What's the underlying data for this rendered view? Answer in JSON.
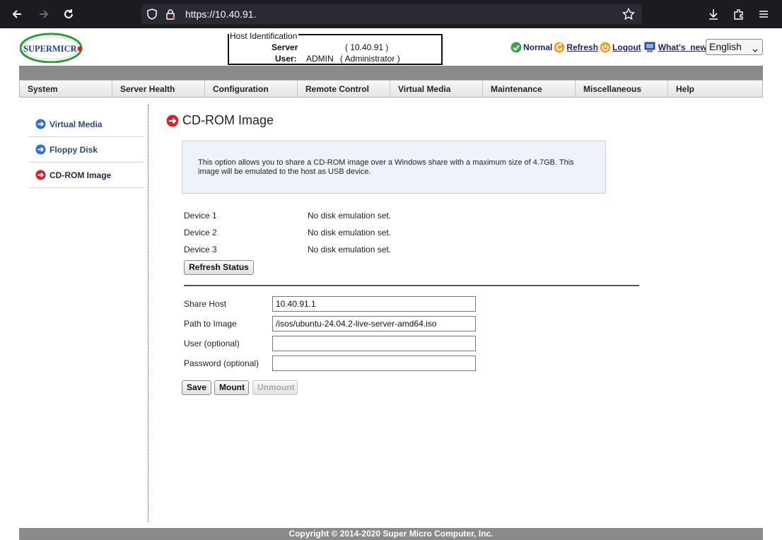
{
  "browser": {
    "url_main": "https://10.40.91.",
    "icons": [
      "back-icon",
      "forward-icon",
      "reload-icon",
      "shield-icon",
      "lock-icon",
      "bookmark-star-icon",
      "download-icon",
      "extensions-icon",
      "menu-icon"
    ]
  },
  "header": {
    "logo_text": "SUPERMICRO",
    "host_box": {
      "legend": "Host Identification",
      "server_label": "Server",
      "server_value": "( 10.40.91          )",
      "user_label": "User:",
      "user_name": "ADMIN",
      "user_role": "( Administrator )"
    },
    "status_label": "Normal",
    "refresh_label": "Refresh",
    "logout_label": "Logout",
    "whats_new_label": "What's_new",
    "language": "English"
  },
  "menu": {
    "items": [
      "System",
      "Server Health",
      "Configuration",
      "Remote Control",
      "Virtual Media",
      "Maintenance",
      "Miscellaneous",
      "Help"
    ]
  },
  "sidebar": {
    "items": [
      {
        "label": "Virtual Media",
        "active": false
      },
      {
        "label": "Floppy Disk",
        "active": false
      },
      {
        "label": "CD-ROM Image",
        "active": true
      }
    ]
  },
  "content": {
    "title": "CD-ROM Image",
    "info": "This option allows you to share a CD-ROM image over a Windows share with a maximum size of 4.7GB. This image will be emulated to the host as USB device.",
    "devices": [
      {
        "label": "Device 1",
        "status": "No disk emulation set."
      },
      {
        "label": "Device 2",
        "status": "No disk emulation set."
      },
      {
        "label": "Device 3",
        "status": "No disk emulation set."
      }
    ],
    "refresh_status_button": "Refresh Status",
    "form": {
      "share_host_label": "Share Host",
      "share_host_value": "10.40.91.1",
      "path_label": "Path to Image",
      "path_value": "/isos/ubuntu-24.04.2-live-server-amd64.iso",
      "user_label": "User (optional)",
      "user_value": "",
      "password_label": "Password (optional)",
      "password_value": ""
    },
    "save_button": "Save",
    "mount_button": "Mount",
    "unmount_button": "Unmount"
  },
  "footer": {
    "copyright": "Copyright © 2014-2020 Super Micro Computer, Inc."
  },
  "colors": {
    "accent_blue": "#1a237e",
    "menu_band": "#8a8a8a",
    "info_bg": "#eef2fb",
    "arrow_blue": "#2d6fd6",
    "arrow_red": "#d8202a"
  }
}
